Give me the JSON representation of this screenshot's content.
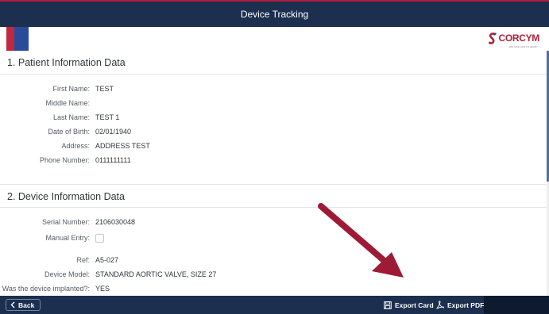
{
  "header": {
    "title": "Device Tracking"
  },
  "brand": {
    "logo_text": "CORCYM",
    "tagline": "WE TAKE LIFE TO HEART"
  },
  "sections": [
    {
      "title": "1. Patient Information Data",
      "fields": [
        {
          "label": "First Name:",
          "value": "TEST"
        },
        {
          "label": "Middle Name:",
          "value": ""
        },
        {
          "label": "Last Name:",
          "value": "TEST 1"
        },
        {
          "label": "Date of Birth:",
          "value": "02/01/1940"
        },
        {
          "label": "Address:",
          "value": "ADDRESS TEST"
        },
        {
          "label": "Phone Number:",
          "value": "0111111111"
        }
      ]
    },
    {
      "title": "2. Device Information Data",
      "fields": [
        {
          "label": "Serial Number:",
          "value": "2106030048"
        },
        {
          "label": "Manual Entry:",
          "value": ""
        },
        {
          "label": "Ref:",
          "value": "A5-027"
        },
        {
          "label": "Device Model:",
          "value": "STANDARD AORTIC VALVE, SIZE 27"
        },
        {
          "label": "Was the device implanted?:",
          "value": "YES"
        }
      ]
    }
  ],
  "footer": {
    "back_label": "Back",
    "export_card_label": "Export Card",
    "export_pdf_label": "Export PDF"
  },
  "colors": {
    "header_bg": "#1c2f4f",
    "brand_red": "#b0213b",
    "brand_blue": "#2b4a9a",
    "annotation_arrow": "#9e1b36"
  },
  "icons": {
    "back": "chevron-left-icon",
    "export_card": "save-icon",
    "export_pdf": "pdf-icon"
  }
}
